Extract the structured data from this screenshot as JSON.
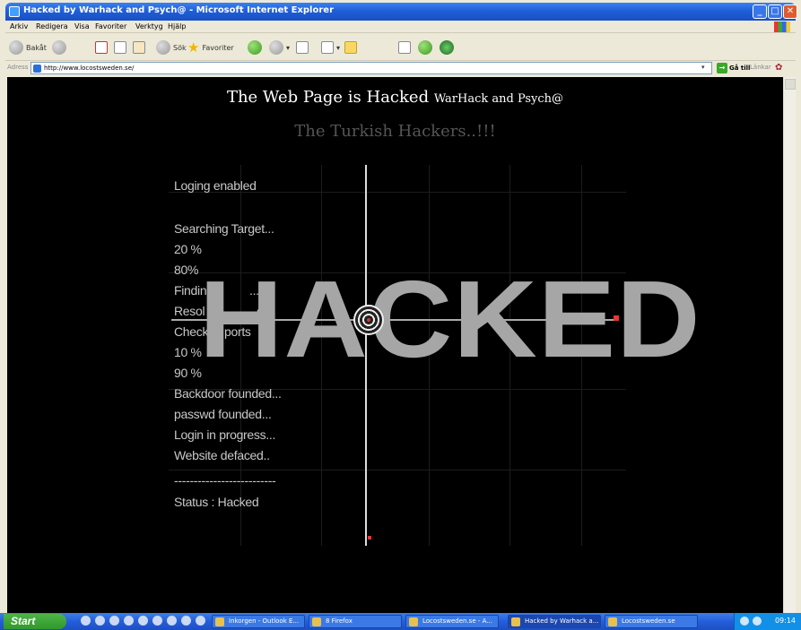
{
  "window": {
    "title": "Hacked by Warhack and Psych@ - Microsoft Internet Explorer",
    "controls": [
      "_",
      "□",
      "✕"
    ]
  },
  "menu": [
    "Arkiv",
    "Redigera",
    "Visa",
    "Favoriter",
    "Verktyg",
    "Hjälp"
  ],
  "toolbar": {
    "back_label": "Bakåt",
    "search_label": "Sök",
    "favorites_label": "Favoriter"
  },
  "address": {
    "label": "Adress",
    "url": "http://www.locostsweden.se/",
    "go_label": "Gå till",
    "links_label": "Länkar"
  },
  "page": {
    "headline_main": "The Web Page is Hacked",
    "headline_small": "WarHack and Psych@",
    "subhead": "The Turkish Hackers..!!!",
    "log": [
      "Loging enabled",
      "",
      "Searching Target...",
      "20 %",
      "80%",
      "Findin",
      "Resol",
      "Checki",
      "10 %",
      "90 %",
      "Backdoor founded...",
      "passwd founded...",
      "Login in progress...",
      "Website defaced..",
      "",
      "--------------------------",
      "Status : Hacked"
    ],
    "log_partial": {
      "finding_tail": "...",
      "resolve_tail": "ed",
      "ports": "ports"
    },
    "banner": "HACKED"
  },
  "taskbar": {
    "start_label": "Start",
    "tasks": [
      "Inkorgen - Outlook E...",
      "8 Firefox",
      "Locostsweden.se - A...",
      "Hacked by Warhack a...",
      "Locostsweden.se"
    ],
    "clock": "09:14"
  }
}
